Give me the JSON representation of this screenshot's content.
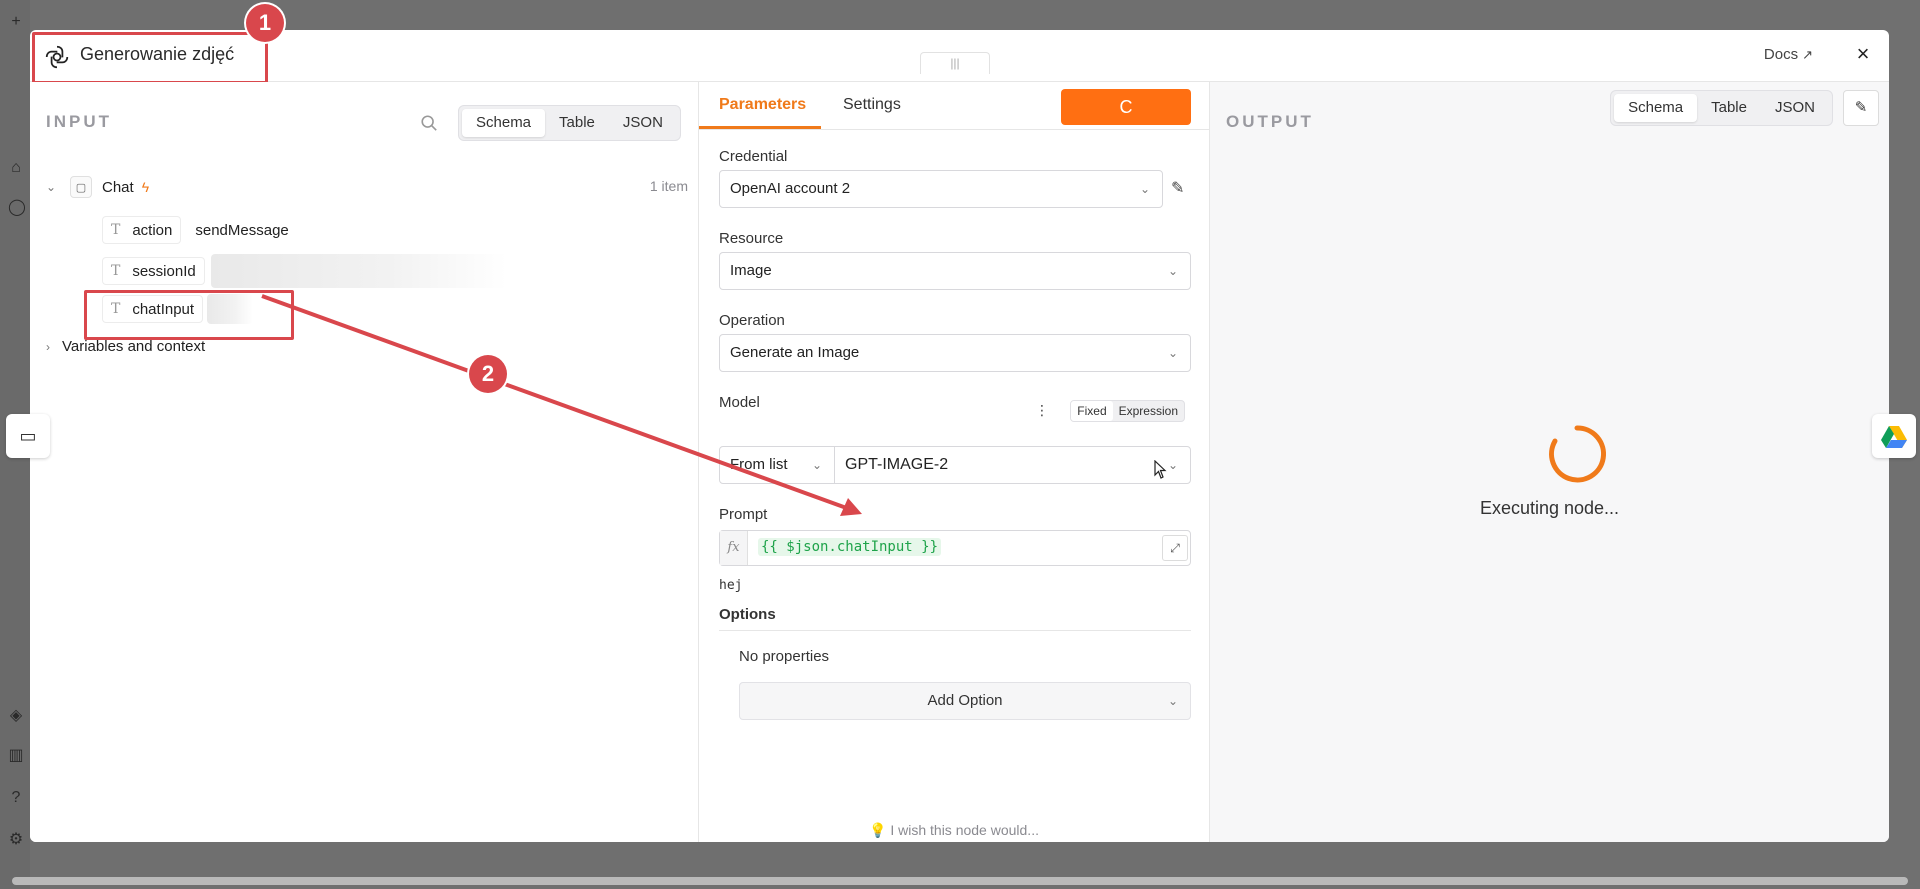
{
  "modal": {
    "title": "Generowanie zdjęć",
    "docs_label": "Docs",
    "close_label": "×"
  },
  "input": {
    "section_label": "INPUT",
    "view_tabs": [
      "Schema",
      "Table",
      "JSON"
    ],
    "active_tab": "Schema",
    "node_name": "Chat",
    "item_count": "1 item",
    "fields": [
      {
        "name": "action",
        "value": "sendMessage"
      },
      {
        "name": "sessionId",
        "value": ""
      },
      {
        "name": "chatInput",
        "value": ""
      }
    ],
    "variables_label": "Variables and context"
  },
  "parameters": {
    "tabs": [
      "Parameters",
      "Settings"
    ],
    "active_tab": "Parameters",
    "execute_label": "C",
    "credential": {
      "label": "Credential",
      "value": "OpenAI account 2"
    },
    "resource": {
      "label": "Resource",
      "value": "Image"
    },
    "operation": {
      "label": "Operation",
      "value": "Generate an Image"
    },
    "model": {
      "label": "Model",
      "mode_toggle": [
        "Fixed",
        "Expression"
      ],
      "source": "From list",
      "value": "GPT-IMAGE-2"
    },
    "prompt": {
      "label": "Prompt",
      "expression": "{{ $json.chatInput }}",
      "preview": "hej"
    },
    "options": {
      "label": "Options",
      "empty_text": "No properties",
      "add_label": "Add Option"
    },
    "feedback": "I wish this node would..."
  },
  "output": {
    "section_label": "OUTPUT",
    "view_tabs": [
      "Schema",
      "Table",
      "JSON"
    ],
    "active_tab": "Schema",
    "status": "Executing node..."
  },
  "annotations": {
    "badge_1": "1",
    "badge_2": "2"
  },
  "colors": {
    "accent": "#ff6f12",
    "annotation_red": "#d9474c",
    "expression_green": "#1ea34a"
  }
}
